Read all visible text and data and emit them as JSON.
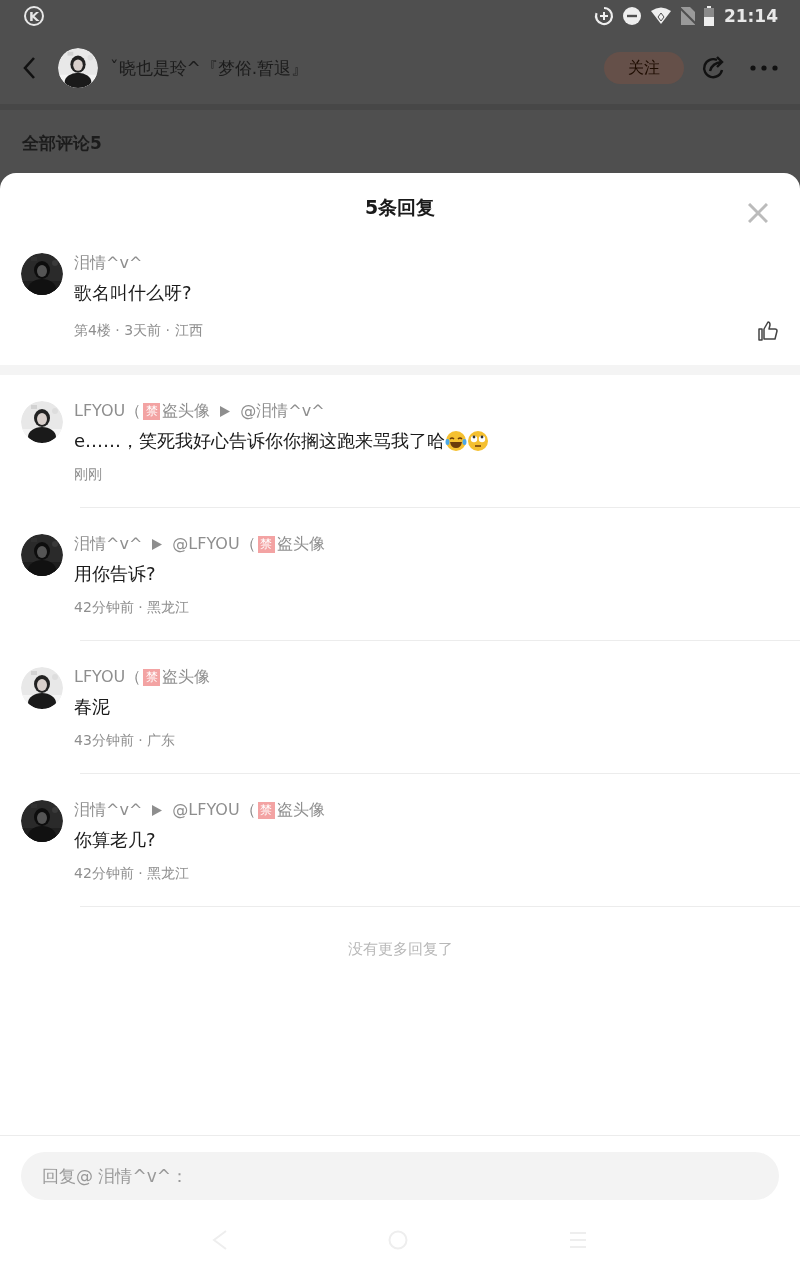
{
  "status_bar": {
    "app_badge": "K",
    "time": "21:14"
  },
  "header": {
    "avatar": {
      "kind": "picture"
    },
    "title": "ˇ晓也是玲^『梦俗.暂退』",
    "follow_label": "关注"
  },
  "section_title": "全部评论5",
  "sheet": {
    "title": "5条回复",
    "comment": {
      "avatar": {
        "kind": "picture"
      },
      "author": [
        {
          "kind": "text",
          "text": "泪情^v^"
        }
      ],
      "content": "歌名叫什么呀?",
      "meta": "第4楼 · 3天前 · 江西",
      "liked": false
    },
    "replies": [
      {
        "avatar": {
          "kind": "picture"
        },
        "author": [
          {
            "kind": "text",
            "text": "LFYOU（"
          },
          {
            "kind": "badge",
            "text": "禁"
          },
          {
            "kind": "text",
            "text": "盗头像"
          }
        ],
        "reply_to": [
          {
            "kind": "text",
            "text": "@泪情^v^"
          }
        ],
        "content": "e……，笑死我好心告诉你你搁这跑来骂我了哈",
        "emoji": [
          {
            "kind": "laugh"
          },
          {
            "kind": "eyeroll"
          }
        ],
        "meta": "刚刚"
      },
      {
        "avatar": {
          "kind": "picture"
        },
        "author": [
          {
            "kind": "text",
            "text": "泪情^v^"
          }
        ],
        "reply_to": [
          {
            "kind": "text",
            "text": "@LFYOU（"
          },
          {
            "kind": "badge",
            "text": "禁"
          },
          {
            "kind": "text",
            "text": "盗头像"
          }
        ],
        "content": "用你告诉?",
        "meta": "42分钟前 · 黑龙江"
      },
      {
        "avatar": {
          "kind": "picture"
        },
        "author": [
          {
            "kind": "text",
            "text": "LFYOU（"
          },
          {
            "kind": "badge",
            "text": "禁"
          },
          {
            "kind": "text",
            "text": "盗头像"
          }
        ],
        "content": "春泥",
        "meta": "43分钟前 · 广东"
      },
      {
        "avatar": {
          "kind": "picture"
        },
        "author": [
          {
            "kind": "text",
            "text": "泪情^v^"
          }
        ],
        "reply_to": [
          {
            "kind": "text",
            "text": "@LFYOU（"
          },
          {
            "kind": "badge",
            "text": "禁"
          },
          {
            "kind": "text",
            "text": "盗头像"
          }
        ],
        "content": "你算老几?",
        "meta": "42分钟前 · 黑龙江"
      }
    ],
    "end_note": "没有更多回复了",
    "reply_input": {
      "placeholder": "回复@ 泪情^v^："
    }
  }
}
